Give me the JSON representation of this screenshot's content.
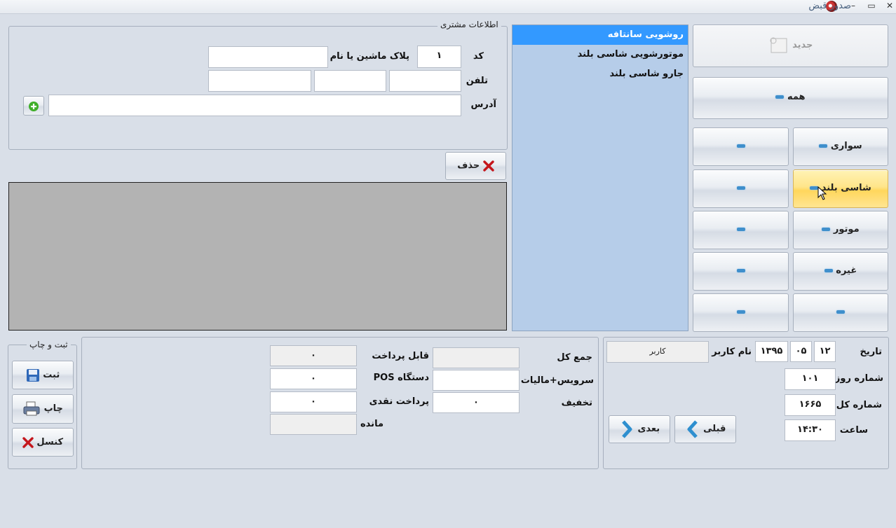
{
  "window": {
    "title": "صدور قبض",
    "minimize": "–",
    "maximize": "▭",
    "close": "✕"
  },
  "customer": {
    "legend": "اطلاعات مشتری",
    "code_label": "کد",
    "code_value": "۱",
    "plate_label": "پلاک ماشین یا نام",
    "plate_value": "",
    "phone_label": "تلفن",
    "phone1": "",
    "phone2": "",
    "phone3": "",
    "address_label": "آدرس",
    "address_value": ""
  },
  "delete_label": "حذف",
  "new_label": "جدید",
  "all_label": "همه",
  "categories": [
    {
      "label": "سواری"
    },
    {
      "label": "شاسی بلند"
    },
    {
      "label": "موتور"
    },
    {
      "label": "غیره"
    },
    {
      "label": ""
    }
  ],
  "services": [
    {
      "label": "روشویی سانتافه"
    },
    {
      "label": "موتورشویی شاسی بلند"
    },
    {
      "label": "جارو شاسی بلند"
    }
  ],
  "payment": {
    "total_label": "جمع کل",
    "total_value": "",
    "service_tax_label": "سرویس+مالیات",
    "service_tax_value": "",
    "discount_label": "تخفیف",
    "discount_value": "۰",
    "payable_label": "قابل پرداخت",
    "payable_value": "۰",
    "pos_label": "دستگاه POS",
    "pos_value": "۰",
    "cash_label": "پرداخت نقدی",
    "cash_value": "۰",
    "remain_label": "مانده",
    "remain_value": ""
  },
  "register": {
    "legend": "ثبت و چاپ",
    "save": "ثبت",
    "print": "چاپ",
    "cancel": "کنسل"
  },
  "info": {
    "date_label": "تاریخ",
    "day": "۱۲",
    "month": "۰۵",
    "year": "۱۳۹۵",
    "user_label": "نام کاربر",
    "user_value": "کاربر",
    "day_number_label": "شماره روز",
    "day_number": "۱۰۱",
    "total_number_label": "شماره کل",
    "total_number": "۱۶۶۵",
    "time_label": "ساعت",
    "time_value": "۱۴:۳۰",
    "prev_label": "قبلی",
    "next_label": "بعدی"
  }
}
